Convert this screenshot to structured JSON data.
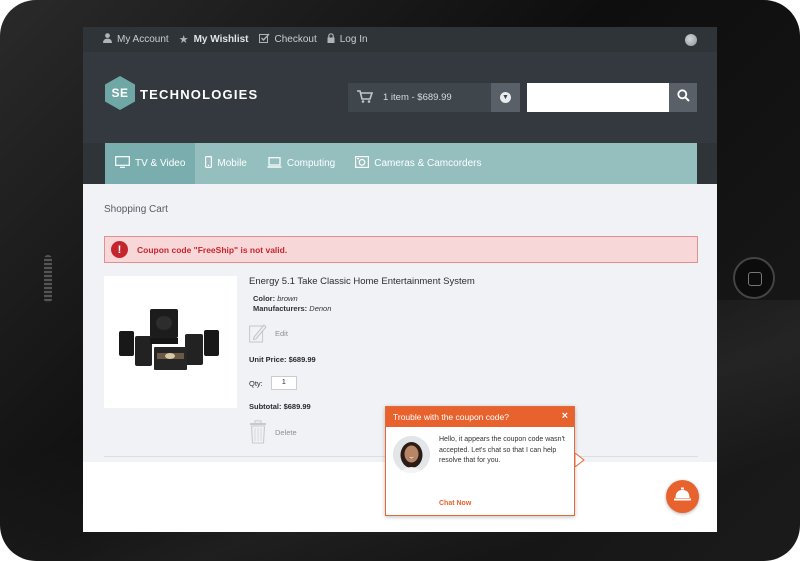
{
  "topbar": {
    "my_account": "My Account",
    "my_wishlist": "My Wishlist",
    "checkout": "Checkout",
    "log_in": "Log In"
  },
  "header": {
    "logo_mark": "SE",
    "logo_text": "TECHNOLOGIES",
    "cart_summary": "1 item - $689.99",
    "search_placeholder": ""
  },
  "nav": {
    "items": [
      {
        "label": "TV & Video",
        "icon": "tv-icon"
      },
      {
        "label": "Mobile",
        "icon": "mobile-icon"
      },
      {
        "label": "Computing",
        "icon": "laptop-icon"
      },
      {
        "label": "Cameras & Camcorders",
        "icon": "camera-icon"
      }
    ]
  },
  "page": {
    "breadcrumb": "Shopping Cart",
    "alert": "Coupon code \"FreeShip\" is not valid."
  },
  "product": {
    "title": "Energy 5.1 Take Classic Home Entertainment System",
    "color_label": "Color:",
    "color_value": "brown",
    "manufacturer_label": "Manufacturers:",
    "manufacturer_value": "Denon",
    "edit_label": "Edit",
    "unit_price": "Unit Price: $689.99",
    "qty_label": "Qty:",
    "qty_value": "1",
    "subtotal": "Subtotal: $689.99",
    "delete_label": "Delete"
  },
  "chat": {
    "title": "Trouble with the coupon code?",
    "close": "×",
    "message": "Hello, it appears the coupon code wasn't accepted. Let's chat so that I can help resolve that for you.",
    "cta": "Chat Now"
  },
  "colors": {
    "accent": "#94bfbe",
    "alert": "#c9252d",
    "chat": "#e8622d"
  }
}
